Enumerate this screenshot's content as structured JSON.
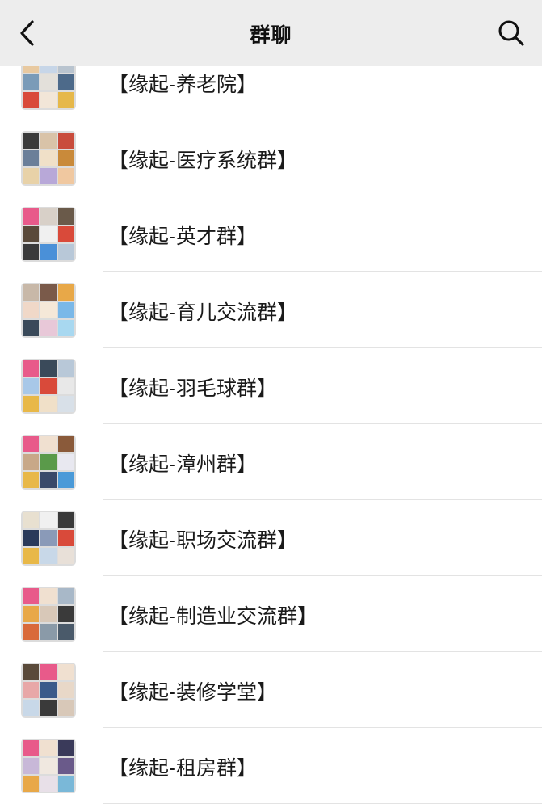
{
  "header": {
    "title": "群聊",
    "back_icon": "chevron-left-icon",
    "search_icon": "search-icon"
  },
  "groups": [
    {
      "name": "【缘起-养老院】",
      "tiles": [
        "#e8c9a0",
        "#c7d6e8",
        "#b9c4cf",
        "#7a9bb8",
        "#e3e0da",
        "#4d6a8a",
        "#d94a3a",
        "#f2e6d8",
        "#e6b84a"
      ]
    },
    {
      "name": "【缘起-医疗系统群】",
      "tiles": [
        "#3a3a3a",
        "#d9c3a8",
        "#c94c3c",
        "#6b7f99",
        "#f0e0c8",
        "#c98a3a",
        "#e8d2a8",
        "#b8a8d8",
        "#f0c8a0"
      ]
    },
    {
      "name": "【缘起-英才群】",
      "tiles": [
        "#e85a8a",
        "#d8d0c8",
        "#6a5a4a",
        "#5a4a3a",
        "#f0f0f0",
        "#d94a3a",
        "#3a3a3a",
        "#4a90d8",
        "#b8c8d8"
      ]
    },
    {
      "name": "【缘起-育儿交流群】",
      "tiles": [
        "#c8b8a8",
        "#7a5a4a",
        "#e8a848",
        "#f0d8c8",
        "#f5e8d8",
        "#7ab8e8",
        "#3a4a5a",
        "#e8c8d8",
        "#a8d8f0"
      ]
    },
    {
      "name": "【缘起-羽毛球群】",
      "tiles": [
        "#e85a8a",
        "#3a4a5a",
        "#b8c8d8",
        "#a8c8e8",
        "#d94a3a",
        "#e8e8e8",
        "#e8b848",
        "#f0e0c8",
        "#d8e0e8"
      ]
    },
    {
      "name": "【缘起-漳州群】",
      "tiles": [
        "#e85a8a",
        "#f0e0d0",
        "#8a5a3a",
        "#c8a888",
        "#5a9a4a",
        "#e8e8f0",
        "#e8b848",
        "#3a4a6a",
        "#4a9ad8"
      ]
    },
    {
      "name": "【缘起-职场交流群】",
      "tiles": [
        "#e8e0d0",
        "#f0f0f0",
        "#3a3a3a",
        "#2a3a5a",
        "#8a9ab8",
        "#d94a3a",
        "#e8b848",
        "#c8d8e8",
        "#e8e0d8"
      ]
    },
    {
      "name": "【缘起-制造业交流群】",
      "tiles": [
        "#e85a8a",
        "#f0e0d0",
        "#a8b8c8",
        "#e8a848",
        "#d8c8b8",
        "#3a3a3a",
        "#d96a3a",
        "#8a9aa8",
        "#4a5a6a"
      ]
    },
    {
      "name": "【缘起-装修学堂】",
      "tiles": [
        "#5a4a3a",
        "#e85a8a",
        "#f0e0d0",
        "#e8a8a8",
        "#3a5a8a",
        "#e8d8c8",
        "#c8d8e8",
        "#3a3a3a",
        "#d8c8b8"
      ]
    },
    {
      "name": "【缘起-租房群】",
      "tiles": [
        "#e85a8a",
        "#f0e0d0",
        "#3a3a5a",
        "#c8b8d8",
        "#f0e8e0",
        "#6a5a8a",
        "#e8a848",
        "#e8e0e8",
        "#7ab8d8"
      ]
    }
  ]
}
